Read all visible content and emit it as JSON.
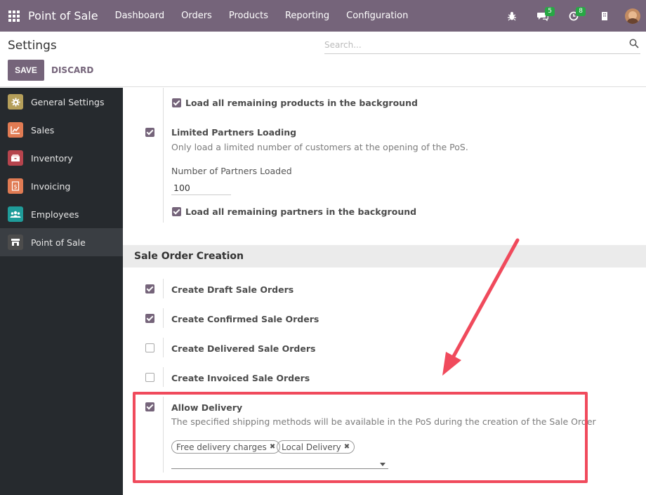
{
  "navbar": {
    "brand": "Point of Sale",
    "menu": [
      "Dashboard",
      "Orders",
      "Products",
      "Reporting",
      "Configuration"
    ],
    "chat_badge": "5",
    "activity_badge": "8"
  },
  "control": {
    "title": "Settings",
    "save_label": "SAVE",
    "discard_label": "DISCARD",
    "search_placeholder": "Search..."
  },
  "sidebar": {
    "items": [
      {
        "label": "General Settings",
        "icon": "gear-icon",
        "color": "#b59f5a"
      },
      {
        "label": "Sales",
        "icon": "chart-icon",
        "color": "#e07b53"
      },
      {
        "label": "Inventory",
        "icon": "box-icon",
        "color": "#b6444d"
      },
      {
        "label": "Invoicing",
        "icon": "invoice-icon",
        "color": "#e07b53"
      },
      {
        "label": "Employees",
        "icon": "users-icon",
        "color": "#1f9c9a"
      },
      {
        "label": "Point of Sale",
        "icon": "shop-icon",
        "color": "#4c4c4c"
      }
    ]
  },
  "products": {
    "load_remaining_label": "Load all remaining products in the background",
    "load_remaining_checked": true
  },
  "partners": {
    "label": "Limited Partners Loading",
    "checked": true,
    "help": "Only load a limited number of customers at the opening of the PoS.",
    "number_label": "Number of Partners Loaded",
    "number_value": "100",
    "load_remaining_label": "Load all remaining partners in the background",
    "load_remaining_checked": true
  },
  "sale_order": {
    "section_title": "Sale Order Creation",
    "options": [
      {
        "label": "Create Draft Sale Orders",
        "checked": true
      },
      {
        "label": "Create Confirmed Sale Orders",
        "checked": true
      },
      {
        "label": "Create Delivered Sale Orders",
        "checked": false
      },
      {
        "label": "Create Invoiced Sale Orders",
        "checked": false
      }
    ],
    "allow_delivery": {
      "label": "Allow Delivery",
      "checked": true,
      "help": "The specified shipping methods will be available in the PoS during the creation of the Sale Order",
      "tags": [
        "Free delivery charges",
        "Local Delivery"
      ]
    }
  },
  "colors": {
    "brand": "#75647a",
    "highlight": "#f04a5c",
    "badge": "#28a745"
  }
}
